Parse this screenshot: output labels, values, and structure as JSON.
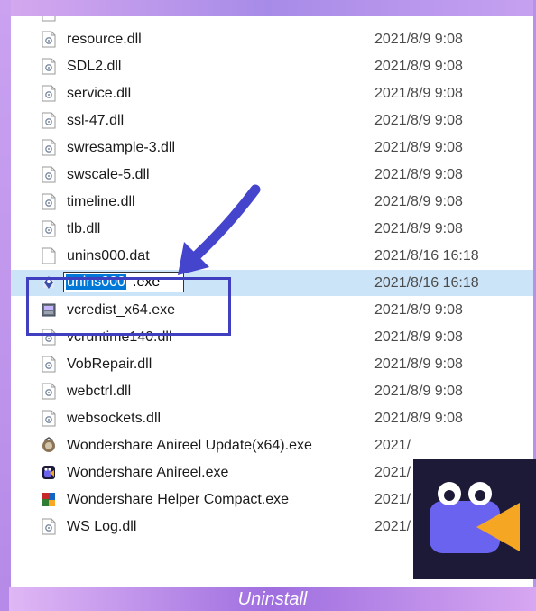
{
  "files": [
    {
      "name": "resource.dll",
      "date": "2021/8/9 9:08",
      "icon": "dll-file-icon"
    },
    {
      "name": "SDL2.dll",
      "date": "2021/8/9 9:08",
      "icon": "dll-file-icon"
    },
    {
      "name": "service.dll",
      "date": "2021/8/9 9:08",
      "icon": "dll-file-icon"
    },
    {
      "name": "ssl-47.dll",
      "date": "2021/8/9 9:08",
      "icon": "dll-file-icon"
    },
    {
      "name": "swresample-3.dll",
      "date": "2021/8/9 9:08",
      "icon": "dll-file-icon"
    },
    {
      "name": "swscale-5.dll",
      "date": "2021/8/9 9:08",
      "icon": "dll-file-icon"
    },
    {
      "name": "timeline.dll",
      "date": "2021/8/9 9:08",
      "icon": "dll-file-icon"
    },
    {
      "name": "tlb.dll",
      "date": "2021/8/9 9:08",
      "icon": "dll-file-icon"
    },
    {
      "name": "unins000.dat",
      "date": "2021/8/16 16:18",
      "icon": "dat-file-icon"
    },
    {
      "name": "unins000.exe",
      "date": "2021/8/16 16:18",
      "icon": "uninstaller-exe-icon",
      "selected": true,
      "rename_selected": "unins000",
      "rename_rest": ".exe"
    },
    {
      "name": "vcredist_x64.exe",
      "date": "2021/8/9 9:08",
      "icon": "installer-exe-icon"
    },
    {
      "name": "vcruntime140.dll",
      "date": "2021/8/9 9:08",
      "icon": "dll-file-icon"
    },
    {
      "name": "VobRepair.dll",
      "date": "2021/8/9 9:08",
      "icon": "dll-file-icon"
    },
    {
      "name": "webctrl.dll",
      "date": "2021/8/9 9:08",
      "icon": "dll-file-icon"
    },
    {
      "name": "websockets.dll",
      "date": "2021/8/9 9:08",
      "icon": "dll-file-icon"
    },
    {
      "name": "Wondershare Anireel Update(x64).exe",
      "date": "2021/",
      "icon": "update-exe-icon"
    },
    {
      "name": "Wondershare Anireel.exe",
      "date": "2021/",
      "icon": "anireel-app-icon"
    },
    {
      "name": "Wondershare Helper Compact.exe",
      "date": "2021/",
      "icon": "helper-exe-icon"
    },
    {
      "name": "WS Log.dll",
      "date": "2021/",
      "icon": "dll-file-icon"
    }
  ],
  "footer": {
    "label": "Uninstall"
  },
  "colors": {
    "selection": "#cce4f7",
    "highlight_border": "#3f3fbf",
    "arrow": "#4444cc",
    "logo_bg": "#1d1a38",
    "logo_body": "#6a63f0",
    "logo_play": "#f5a623"
  }
}
